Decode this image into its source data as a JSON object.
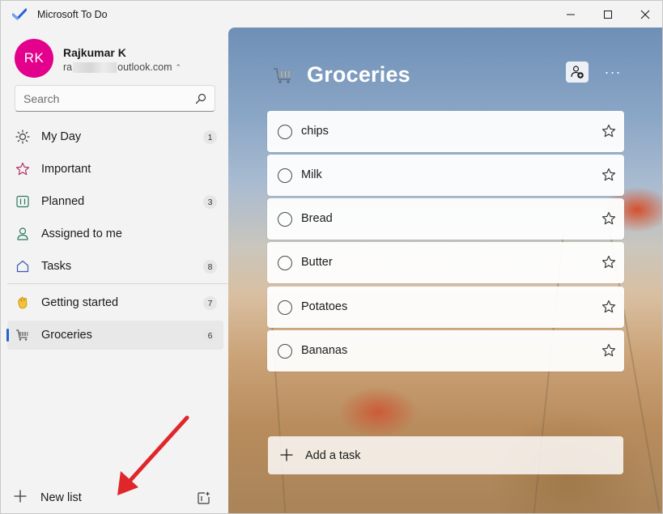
{
  "window": {
    "title": "Microsoft To Do",
    "controls": [
      "minimize",
      "maximize",
      "close"
    ]
  },
  "profile": {
    "initials": "RK",
    "name": "Rajkumar K",
    "email_prefix": "ra",
    "email_suffix": "outlook.com",
    "avatar_color": "#e3008c"
  },
  "search": {
    "placeholder": "Search"
  },
  "nav": {
    "items": [
      {
        "label": "My Day",
        "count": "1",
        "icon": "sun-icon"
      },
      {
        "label": "Important",
        "count": "",
        "icon": "star-icon"
      },
      {
        "label": "Planned",
        "count": "3",
        "icon": "calendar-icon"
      },
      {
        "label": "Assigned to me",
        "count": "",
        "icon": "person-icon"
      },
      {
        "label": "Tasks",
        "count": "8",
        "icon": "home-icon"
      }
    ],
    "lists": [
      {
        "label": "Getting started",
        "count": "7",
        "icon": "waving-hand-icon"
      },
      {
        "label": "Groceries",
        "count": "6",
        "icon": "shopping-cart-icon",
        "selected": true
      }
    ],
    "new_list_label": "New list"
  },
  "main": {
    "title": "Groceries",
    "tasks": [
      {
        "title": "chips"
      },
      {
        "title": "Milk"
      },
      {
        "title": "Bread"
      },
      {
        "title": "Butter"
      },
      {
        "title": "Potatoes"
      },
      {
        "title": "Bananas"
      }
    ],
    "add_task_label": "Add a task"
  },
  "colors": {
    "accent": "#2564cf",
    "annotation_arrow": "#e0262b"
  }
}
